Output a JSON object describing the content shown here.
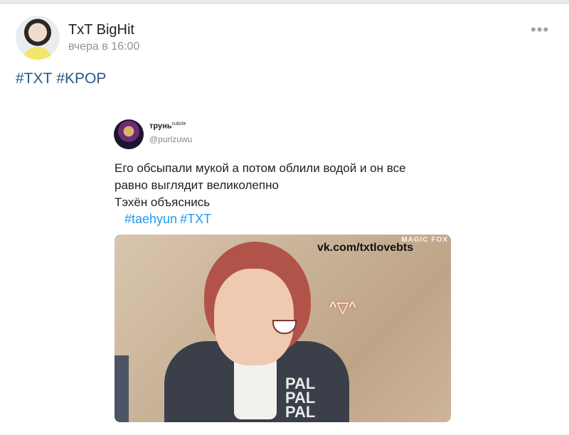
{
  "post": {
    "author": "TxT BigHit",
    "time": "вчера в 16:00",
    "hashtags": [
      "#TXT",
      "#KPOP"
    ],
    "more_icon": "•••"
  },
  "tweet": {
    "name": "трунь",
    "name_suffix": "cuticle",
    "handle": "@purlzuwu",
    "text_lines": [
      "Его обсыпали мукой а потом облили водой и он все",
      "равно выглядит великолепно",
      "Тэхён объяснись"
    ],
    "hashtags": [
      "#taehyun",
      "#TXT"
    ]
  },
  "media": {
    "watermark": "vk.com/txtlovebts",
    "corner_mark": "MAGIC FOX",
    "shirt_print": "PAL\nPAL\nPAL",
    "emoji_text": "^▽^"
  },
  "colors": {
    "link": "#2a5885",
    "twitter_link": "#1d9bf0",
    "muted": "#939393"
  }
}
